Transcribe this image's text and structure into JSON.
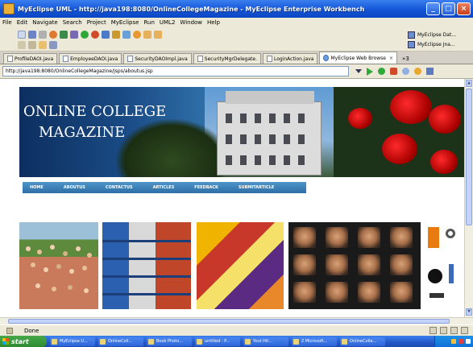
{
  "window": {
    "title": "MyEclipse UML - http://java198:8080/OnlineCollegeMagazine - MyEclipse Enterprise Workbench",
    "buttons": {
      "minimize": "_",
      "maximize": "□",
      "close": "×"
    }
  },
  "menu": [
    "File",
    "Edit",
    "Navigate",
    "Search",
    "Project",
    "MyEclipse",
    "Run",
    "UML2",
    "Window",
    "Help"
  ],
  "perspectives": [
    "MyEclipse Dat...",
    "MyEclipse Jna..."
  ],
  "tabs": [
    {
      "label": "ProfileDAOI.java",
      "active": false
    },
    {
      "label": "EmployeeDAOI.java",
      "active": false
    },
    {
      "label": "SecurityDAOImpl.java",
      "active": false
    },
    {
      "label": "SecurityMgrDelegate.",
      "active": false
    },
    {
      "label": "LoginAction.java",
      "active": false
    },
    {
      "label": "MyEclipse Web Browse",
      "active": true
    }
  ],
  "tabs_overflow": "»3",
  "browser": {
    "url": "http://java198:8080/OnlineCollegeMagazine/jsps/aboutus.jsp"
  },
  "page": {
    "header_line1": "ONLINE COLLEGE",
    "header_line2": "MAGAZINE",
    "nav": [
      "HOME",
      "ABOUTUS",
      "CONTACTUS",
      "ARTICLES",
      "FEEDBACK",
      "SUBMITARTICLE"
    ]
  },
  "status": {
    "text": "Done"
  },
  "taskbar": {
    "start": "start",
    "tasks": [
      "MyEclipse U...",
      "OnlineColl...",
      "Book Photo...",
      "untitled - P...",
      "Yout Hit...",
      "2 Microsoft...",
      "OnlineColle..."
    ]
  },
  "colors": {
    "title_bar": "#1355d6",
    "chrome": "#ece9d8",
    "nav_bar": "#2d6ea6",
    "taskbar": "#2457c8",
    "start": "#2e8a31"
  }
}
